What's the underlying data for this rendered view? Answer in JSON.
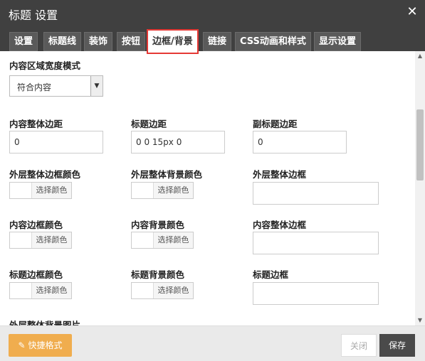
{
  "window": {
    "title": "标题 设置",
    "close_icon": "close-icon"
  },
  "tabs": [
    {
      "label": "设置"
    },
    {
      "label": "标题线"
    },
    {
      "label": "装饰"
    },
    {
      "label": "按钮"
    },
    {
      "label": "边框/背景",
      "active": true
    },
    {
      "label": "链接"
    },
    {
      "label": "CSS动画和样式"
    },
    {
      "label": "显示设置"
    }
  ],
  "width_mode": {
    "label": "内容区域宽度模式",
    "value": "符合内容"
  },
  "spacing": {
    "content_padding": {
      "label": "内容整体边距",
      "value": "0"
    },
    "title_padding": {
      "label": "标题边距",
      "value": "0 0 15px 0"
    },
    "subtitle_padding": {
      "label": "副标题边距",
      "value": "0"
    }
  },
  "outer": {
    "border_color": {
      "label": "外层整体边框颜色",
      "button": "选择颜色"
    },
    "bg_color": {
      "label": "外层整体背景颜色",
      "button": "选择颜色"
    },
    "border": {
      "label": "外层整体边框"
    }
  },
  "inner": {
    "border_color": {
      "label": "内容边框颜色",
      "button": "选择颜色"
    },
    "bg_color": {
      "label": "内容背景颜色",
      "button": "选择颜色"
    },
    "border": {
      "label": "内容整体边框"
    }
  },
  "title_style": {
    "border_color": {
      "label": "标题边框颜色",
      "button": "选择颜色"
    },
    "bg_color": {
      "label": "标题背景颜色",
      "button": "选择颜色"
    },
    "border": {
      "label": "标题边框"
    }
  },
  "outer_bg_image": {
    "label": "外层整体背景图片"
  },
  "footer": {
    "quick_format": "快捷格式",
    "close": "关闭",
    "save": "保存"
  }
}
